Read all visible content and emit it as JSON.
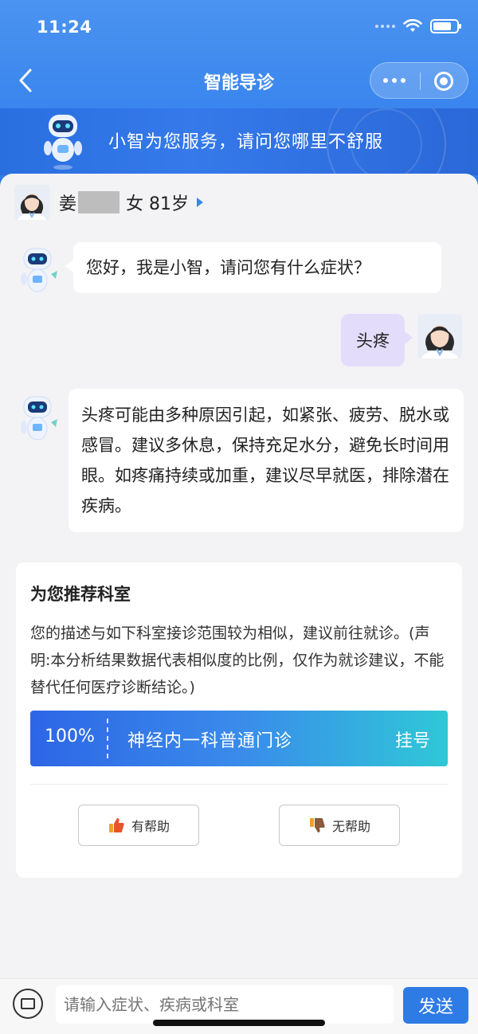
{
  "status_bar": {
    "time": "11:24"
  },
  "navbar": {
    "title": "智能导诊"
  },
  "banner": {
    "text": "小智为您服务，请问您哪里不舒服"
  },
  "patient": {
    "surname": "姜",
    "gender_age": "女 81岁"
  },
  "chat": {
    "bot_greeting": "您好，我是小智，请问您有什么症状？",
    "user_message": "头疼",
    "bot_reply": "头疼可能由多种原因引起，如紧张、疲劳、脱水或感冒。建议多休息，保持充足水分，避免长时间用眼。如疼痛持续或加重，建议尽早就医，排除潜在疾病。"
  },
  "recommendation": {
    "title": "为您推荐科室",
    "description": "您的描述与如下科室接诊范围较为相似，建议前往就诊。(声明:本分析结果数据代表相似度的比例，仅作为就诊建议，不能替代任何医疗诊断结论。)",
    "department": {
      "percent": "100%",
      "name": "神经内一科普通门诊",
      "register_label": "挂号"
    },
    "helpful_label": "有帮助",
    "unhelpful_label": "无帮助"
  },
  "input_bar": {
    "placeholder": "请输入症状、疾病或科室",
    "send_label": "发送"
  },
  "colors": {
    "primary": "#2f7be6",
    "user_bubble": "#e3dcfb",
    "background": "#f3f3f5"
  }
}
